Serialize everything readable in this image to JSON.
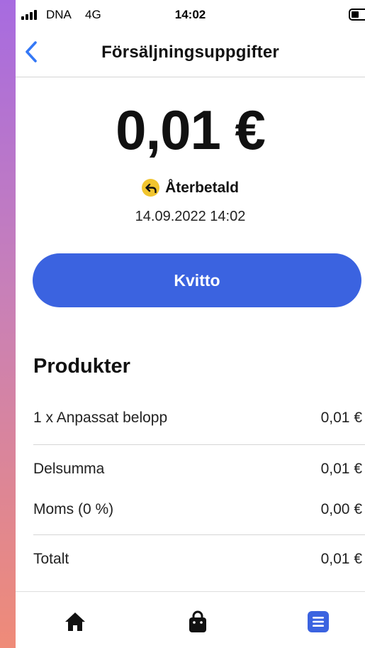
{
  "status_bar": {
    "carrier": "DNA",
    "network": "4G",
    "time": "14:02"
  },
  "nav": {
    "title": "Försäljningsuppgifter",
    "back_icon": "chevron-left-icon"
  },
  "sale": {
    "amount": "0,01 €",
    "status": "Återbetald",
    "status_icon": "refund-arrow-icon",
    "status_color": "#f1c52f",
    "datetime": "14.09.2022 14:02"
  },
  "receipt_button": {
    "label": "Kvitto",
    "color": "#3b63e0"
  },
  "products": {
    "title": "Produkter",
    "items": [
      {
        "label": "1 x Anpassat belopp",
        "value": "0,01 €"
      }
    ],
    "subtotal": {
      "label": "Delsumma",
      "value": "0,01 €"
    },
    "vat": {
      "label": "Moms (0 %)",
      "value": "0,00 €"
    },
    "total": {
      "label": "Totalt",
      "value": "0,01 €"
    }
  },
  "tabbar": {
    "items": [
      {
        "name": "home",
        "icon": "home-icon"
      },
      {
        "name": "shop",
        "icon": "shopping-bag-icon"
      },
      {
        "name": "sales-list",
        "icon": "list-icon",
        "active": true
      }
    ],
    "active_color": "#3b63e0"
  }
}
